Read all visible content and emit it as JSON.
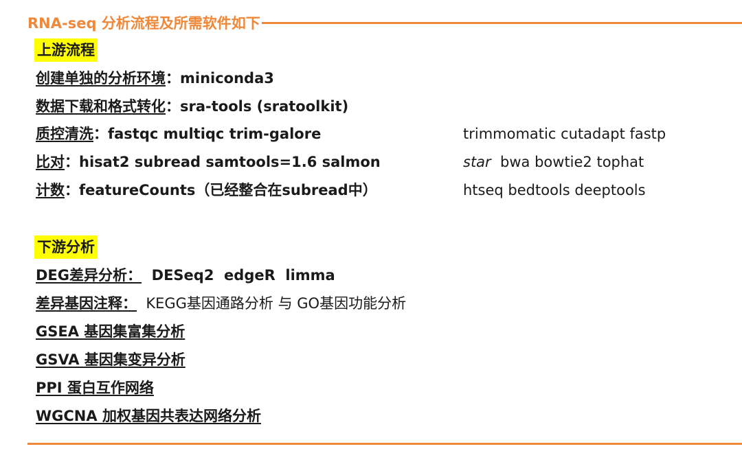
{
  "header": {
    "title": "RNA-seq 分析流程及所需软件如下"
  },
  "upstream": {
    "heading": "上游流程",
    "rows": [
      {
        "label": "创建单独的分析环境",
        "sep": "：",
        "tools": "miniconda3",
        "alt": ""
      },
      {
        "label": "数据下载和格式转化",
        "sep": "：",
        "tools": "sra-tools (sratoolkit)",
        "alt": ""
      },
      {
        "label": "质控清洗",
        "sep": "：",
        "tools": "fastqc  multiqc trim-galore",
        "alt": "trimmomatic cutadapt fastp"
      },
      {
        "label": "比对",
        "sep": "：",
        "tools": "hisat2  subread  samtools=1.6  salmon",
        "alt_italic": "star",
        "alt": "  bwa bowtie2 tophat"
      },
      {
        "label": "计数",
        "sep": "：",
        "tools": "featureCounts（已经整合在subread中）",
        "alt": "htseq  bedtools deeptools"
      }
    ]
  },
  "downstream": {
    "heading": "下游分析",
    "rows": [
      {
        "label": "DEG差异分析：",
        "tools": "  DESeq2  edgeR  limma"
      },
      {
        "label": "差异基因注释：",
        "plain": "  KEGG基因通路分析 与 GO基因功能分析"
      },
      {
        "label": "GSEA 基因集富集分析"
      },
      {
        "label": "GSVA 基因集变异分析"
      },
      {
        "label": "PPI 蛋白互作网络"
      },
      {
        "label": "WGCNA 加权基因共表达网络分析"
      }
    ]
  },
  "colors": {
    "accent": "#f0883a",
    "highlight": "#ffff00"
  }
}
